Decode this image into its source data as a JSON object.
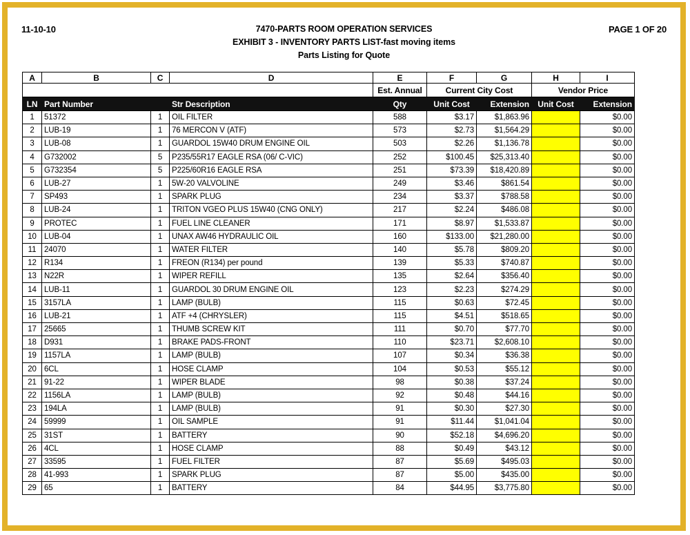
{
  "header": {
    "date": "11-10-10",
    "page_label": "PAGE 1 OF 20",
    "title_line_1": "7470-PARTS ROOM OPERATION SERVICES",
    "title_line_2": "EXHIBIT 3 - INVENTORY PARTS LIST-fast moving items",
    "title_line_3": "Parts Listing for Quote"
  },
  "colors": {
    "frame": "#e3b229",
    "header_band": "#111111",
    "highlight": "#ffff00"
  },
  "sheet": {
    "column_letters": [
      "A",
      "B",
      "C",
      "D",
      "E",
      "F",
      "G",
      "H",
      "I"
    ],
    "group_headers": {
      "blank": "",
      "est_annual": "Est. Annual",
      "current_city_cost": "Current City Cost",
      "vendor_price": "Vendor Price"
    },
    "column_titles": {
      "ln": "LN",
      "part_number": "Part Number",
      "str_description": "Str Description",
      "qty": "Qty",
      "city_unit_cost": "Unit Cost",
      "city_extension": "Extension",
      "vendor_unit_cost": "Unit Cost",
      "vendor_extension": "Extension"
    },
    "rows": [
      {
        "ln": "1",
        "part": "51372",
        "str": "1",
        "desc": "OIL FILTER",
        "qty": "588",
        "unit": "$3.17",
        "ext": "$1,863.96",
        "vunit": "",
        "vext": "$0.00"
      },
      {
        "ln": "2",
        "part": "LUB-19",
        "str": "1",
        "desc": "76 MERCON V (ATF)",
        "qty": "573",
        "unit": "$2.73",
        "ext": "$1,564.29",
        "vunit": "",
        "vext": "$0.00"
      },
      {
        "ln": "3",
        "part": "LUB-08",
        "str": "1",
        "desc": "GUARDOL 15W40 DRUM ENGINE OIL",
        "qty": "503",
        "unit": "$2.26",
        "ext": "$1,136.78",
        "vunit": "",
        "vext": "$0.00"
      },
      {
        "ln": "4",
        "part": "G732002",
        "str": "5",
        "desc": "P235/55R17 EAGLE RSA (06/ C-VIC)",
        "qty": "252",
        "unit": "$100.45",
        "ext": "$25,313.40",
        "vunit": "",
        "vext": "$0.00"
      },
      {
        "ln": "5",
        "part": "G732354",
        "str": "5",
        "desc": "P225/60R16 EAGLE RSA",
        "qty": "251",
        "unit": "$73.39",
        "ext": "$18,420.89",
        "vunit": "",
        "vext": "$0.00"
      },
      {
        "ln": "6",
        "part": "LUB-27",
        "str": "1",
        "desc": "5W-20 VALVOLINE",
        "qty": "249",
        "unit": "$3.46",
        "ext": "$861.54",
        "vunit": "",
        "vext": "$0.00"
      },
      {
        "ln": "7",
        "part": "SP493",
        "str": "1",
        "desc": "SPARK PLUG",
        "qty": "234",
        "unit": "$3.37",
        "ext": "$788.58",
        "vunit": "",
        "vext": "$0.00"
      },
      {
        "ln": "8",
        "part": "LUB-24",
        "str": "1",
        "desc": "TRITON VGEO PLUS 15W40 (CNG ONLY)",
        "qty": "217",
        "unit": "$2.24",
        "ext": "$486.08",
        "vunit": "",
        "vext": "$0.00"
      },
      {
        "ln": "9",
        "part": "PROTEC",
        "str": "1",
        "desc": "FUEL LINE CLEANER",
        "qty": "171",
        "unit": "$8.97",
        "ext": "$1,533.87",
        "vunit": "",
        "vext": "$0.00"
      },
      {
        "ln": "10",
        "part": "LUB-04",
        "str": "1",
        "desc": "UNAX AW46 HYDRAULIC OIL",
        "qty": "160",
        "unit": "$133.00",
        "ext": "$21,280.00",
        "vunit": "",
        "vext": "$0.00"
      },
      {
        "ln": "11",
        "part": "24070",
        "str": "1",
        "desc": "WATER FILTER",
        "qty": "140",
        "unit": "$5.78",
        "ext": "$809.20",
        "vunit": "",
        "vext": "$0.00"
      },
      {
        "ln": "12",
        "part": "R134",
        "str": "1",
        "desc": "FREON (R134) per pound",
        "qty": "139",
        "unit": "$5.33",
        "ext": "$740.87",
        "vunit": "",
        "vext": "$0.00"
      },
      {
        "ln": "13",
        "part": "N22R",
        "str": "1",
        "desc": "WIPER REFILL",
        "qty": "135",
        "unit": "$2.64",
        "ext": "$356.40",
        "vunit": "",
        "vext": "$0.00"
      },
      {
        "ln": "14",
        "part": "LUB-11",
        "str": "1",
        "desc": "GUARDOL 30 DRUM ENGINE OIL",
        "qty": "123",
        "unit": "$2.23",
        "ext": "$274.29",
        "vunit": "",
        "vext": "$0.00"
      },
      {
        "ln": "15",
        "part": "3157LA",
        "str": "1",
        "desc": "LAMP (BULB)",
        "qty": "115",
        "unit": "$0.63",
        "ext": "$72.45",
        "vunit": "",
        "vext": "$0.00"
      },
      {
        "ln": "16",
        "part": "LUB-21",
        "str": "1",
        "desc": "ATF +4 (CHRYSLER)",
        "qty": "115",
        "unit": "$4.51",
        "ext": "$518.65",
        "vunit": "",
        "vext": "$0.00"
      },
      {
        "ln": "17",
        "part": "25665",
        "str": "1",
        "desc": "THUMB SCREW KIT",
        "qty": "111",
        "unit": "$0.70",
        "ext": "$77.70",
        "vunit": "",
        "vext": "$0.00"
      },
      {
        "ln": "18",
        "part": "D931",
        "str": "1",
        "desc": "BRAKE PADS-FRONT",
        "qty": "110",
        "unit": "$23.71",
        "ext": "$2,608.10",
        "vunit": "",
        "vext": "$0.00"
      },
      {
        "ln": "19",
        "part": "1157LA",
        "str": "1",
        "desc": "LAMP (BULB)",
        "qty": "107",
        "unit": "$0.34",
        "ext": "$36.38",
        "vunit": "",
        "vext": "$0.00"
      },
      {
        "ln": "20",
        "part": "6CL",
        "str": "1",
        "desc": "HOSE CLAMP",
        "qty": "104",
        "unit": "$0.53",
        "ext": "$55.12",
        "vunit": "",
        "vext": "$0.00"
      },
      {
        "ln": "21",
        "part": "91-22",
        "str": "1",
        "desc": "WIPER BLADE",
        "qty": "98",
        "unit": "$0.38",
        "ext": "$37.24",
        "vunit": "",
        "vext": "$0.00"
      },
      {
        "ln": "22",
        "part": "1156LA",
        "str": "1",
        "desc": "LAMP (BULB)",
        "qty": "92",
        "unit": "$0.48",
        "ext": "$44.16",
        "vunit": "",
        "vext": "$0.00"
      },
      {
        "ln": "23",
        "part": "194LA",
        "str": "1",
        "desc": "LAMP (BULB)",
        "qty": "91",
        "unit": "$0.30",
        "ext": "$27.30",
        "vunit": "",
        "vext": "$0.00"
      },
      {
        "ln": "24",
        "part": "59999",
        "str": "1",
        "desc": "OIL SAMPLE",
        "qty": "91",
        "unit": "$11.44",
        "ext": "$1,041.04",
        "vunit": "",
        "vext": "$0.00"
      },
      {
        "ln": "25",
        "part": "31ST",
        "str": "1",
        "desc": "BATTERY",
        "qty": "90",
        "unit": "$52.18",
        "ext": "$4,696.20",
        "vunit": "",
        "vext": "$0.00"
      },
      {
        "ln": "26",
        "part": "4CL",
        "str": "1",
        "desc": "HOSE CLAMP",
        "qty": "88",
        "unit": "$0.49",
        "ext": "$43.12",
        "vunit": "",
        "vext": "$0.00"
      },
      {
        "ln": "27",
        "part": "33595",
        "str": "1",
        "desc": "FUEL FILTER",
        "qty": "87",
        "unit": "$5.69",
        "ext": "$495.03",
        "vunit": "",
        "vext": "$0.00"
      },
      {
        "ln": "28",
        "part": "41-993",
        "str": "1",
        "desc": "SPARK PLUG",
        "qty": "87",
        "unit": "$5.00",
        "ext": "$435.00",
        "vunit": "",
        "vext": "$0.00"
      },
      {
        "ln": "29",
        "part": "65",
        "str": "1",
        "desc": "BATTERY",
        "qty": "84",
        "unit": "$44.95",
        "ext": "$3,775.80",
        "vunit": "",
        "vext": "$0.00"
      }
    ]
  }
}
